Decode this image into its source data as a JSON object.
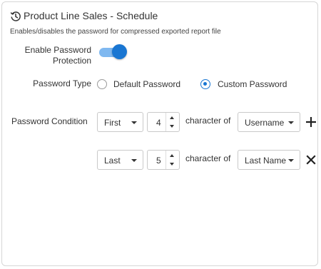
{
  "header": {
    "title": "Product Line Sales - Schedule",
    "subtitle": "Enables/disables the password for compressed exported report file",
    "icon": "history-icon"
  },
  "password_protection": {
    "label_line1": "Enable Password",
    "label_line2": "Protection",
    "enabled": true,
    "accent": "#1976d2"
  },
  "password_type": {
    "label": "Password Type",
    "options": [
      {
        "label": "Default Password",
        "selected": false
      },
      {
        "label": "Custom Password",
        "selected": true
      }
    ]
  },
  "password_condition": {
    "label": "Password Condition",
    "connector_text": "character of",
    "rows": [
      {
        "position": "First",
        "count": "4",
        "field": "Username",
        "action": "plus-icon"
      },
      {
        "position": "Last",
        "count": "5",
        "field": "Last Name",
        "action": "close-icon"
      }
    ]
  }
}
